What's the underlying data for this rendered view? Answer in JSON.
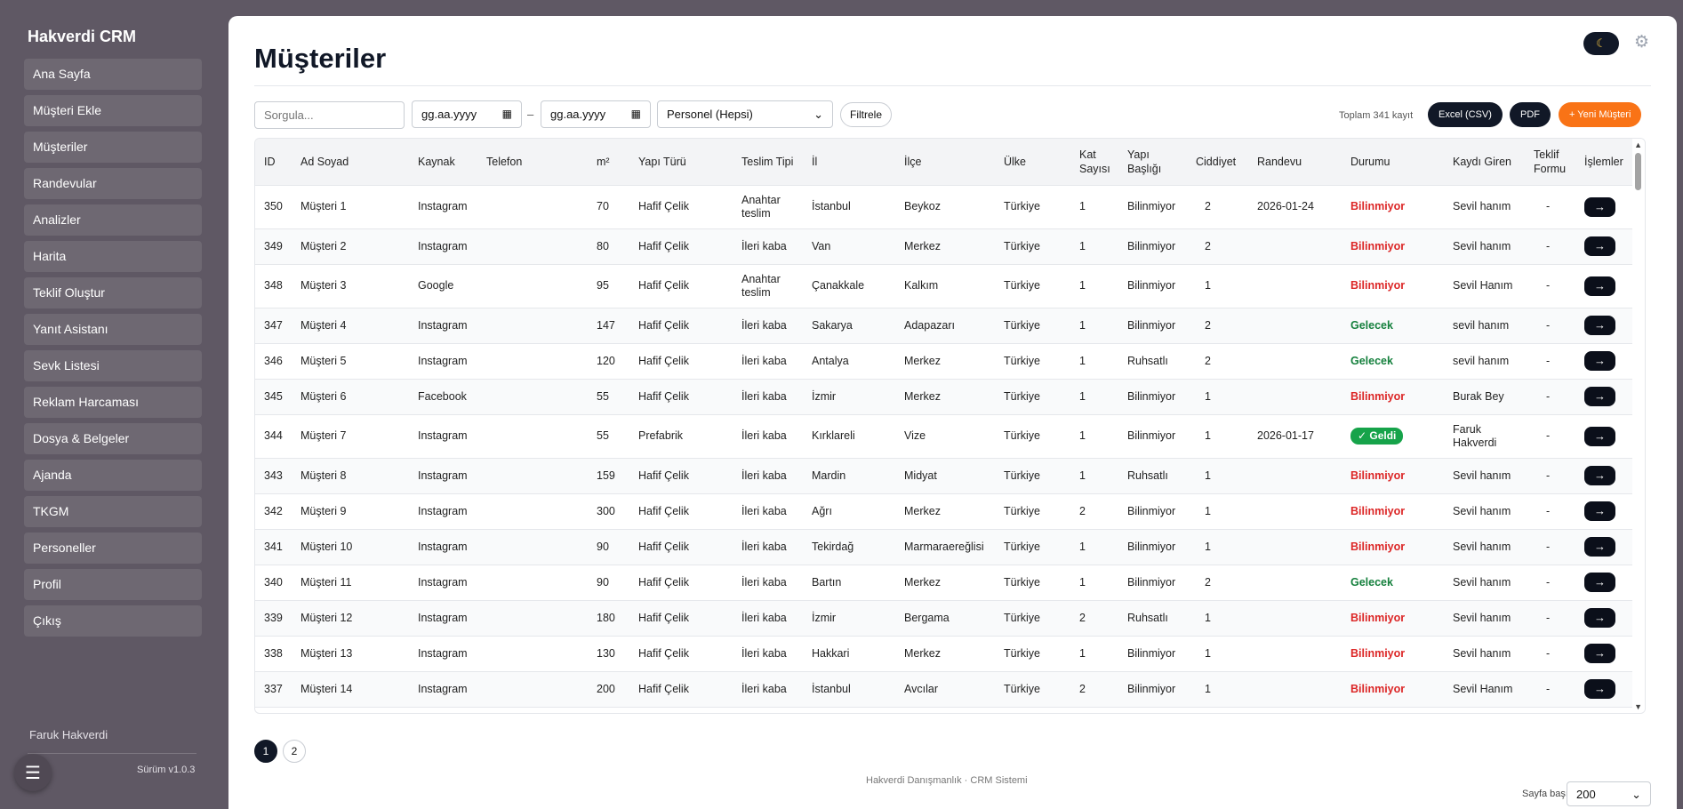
{
  "brand": "Hakverdi CRM",
  "nav": [
    "Ana Sayfa",
    "Müşteri Ekle",
    "Müşteriler",
    "Randevular",
    "Analizler",
    "Harita",
    "Teklif Oluştur",
    "Yanıt Asistanı",
    "Sevk Listesi",
    "Reklam Harcaması",
    "Dosya & Belgeler",
    "Ajanda",
    "TKGM",
    "Personeller",
    "Profil",
    "Çıkış"
  ],
  "user_name": "Faruk Hakverdi",
  "version": "Sürüm v1.0.3",
  "page_title": "Müşteriler",
  "toolbar": {
    "search_placeholder": "Sorgula...",
    "date_from": "gg.aa.yyyy",
    "date_to": "gg.aa.yyyy",
    "date_sep": "–",
    "personnel": "Personel (Hepsi)",
    "filter": "Filtrele",
    "total": "Toplam 341 kayıt",
    "excel": "Excel (CSV)",
    "pdf": "PDF",
    "new_customer": "+ Yeni Müşteri"
  },
  "columns": [
    "ID",
    "Ad Soyad",
    "Kaynak",
    "Telefon",
    "m²",
    "Yapı Türü",
    "Teslim Tipi",
    "İl",
    "İlçe",
    "Ülke",
    "Kat Sayısı",
    "Yapı Başlığı",
    "Ciddiyet",
    "Randevu",
    "Durumu",
    "Kaydı Giren",
    "Teklif Formu",
    "İşlemler"
  ],
  "rows": [
    {
      "id": "350",
      "name": "Müşteri 1",
      "source": "Instagram",
      "phone": "",
      "m2": "70",
      "type": "Hafif Çelik",
      "delivery": "Anahtar teslim",
      "city": "İstanbul",
      "district": "Beykoz",
      "country": "Türkiye",
      "floors": "1",
      "permit": "Bilinmiyor",
      "seriousness": "2",
      "appointment": "2026-01-24",
      "status": "Bilinmiyor",
      "status_kind": "red",
      "entered_by": "Sevil hanım",
      "offer": "-",
      "action": "→"
    },
    {
      "id": "349",
      "name": "Müşteri 2",
      "source": "Instagram",
      "phone": "",
      "m2": "80",
      "type": "Hafif Çelik",
      "delivery": "İleri kaba",
      "city": "Van",
      "district": "Merkez",
      "country": "Türkiye",
      "floors": "1",
      "permit": "Bilinmiyor",
      "seriousness": "2",
      "appointment": "",
      "status": "Bilinmiyor",
      "status_kind": "red",
      "entered_by": "Sevil hanım",
      "offer": "-",
      "action": "→"
    },
    {
      "id": "348",
      "name": "Müşteri 3",
      "source": "Google",
      "phone": "",
      "m2": "95",
      "type": "Hafif Çelik",
      "delivery": "Anahtar teslim",
      "city": "Çanakkale",
      "district": "Kalkım",
      "country": "Türkiye",
      "floors": "1",
      "permit": "Bilinmiyor",
      "seriousness": "1",
      "appointment": "",
      "status": "Bilinmiyor",
      "status_kind": "red",
      "entered_by": "Sevil Hanım",
      "offer": "-",
      "action": "→"
    },
    {
      "id": "347",
      "name": "Müşteri 4",
      "source": "Instagram",
      "phone": "",
      "m2": "147",
      "type": "Hafif Çelik",
      "delivery": "İleri kaba",
      "city": "Sakarya",
      "district": "Adapazarı",
      "country": "Türkiye",
      "floors": "1",
      "permit": "Bilinmiyor",
      "seriousness": "2",
      "appointment": "",
      "status": "Gelecek",
      "status_kind": "green",
      "entered_by": "sevil hanım",
      "offer": "-",
      "action": "→"
    },
    {
      "id": "346",
      "name": "Müşteri 5",
      "source": "Instagram",
      "phone": "",
      "m2": "120",
      "type": "Hafif Çelik",
      "delivery": "İleri kaba",
      "city": "Antalya",
      "district": "Merkez",
      "country": "Türkiye",
      "floors": "1",
      "permit": "Ruhsatlı",
      "seriousness": "2",
      "appointment": "",
      "status": "Gelecek",
      "status_kind": "green",
      "entered_by": "sevil hanım",
      "offer": "-",
      "action": "→"
    },
    {
      "id": "345",
      "name": "Müşteri 6",
      "source": "Facebook",
      "phone": "",
      "m2": "55",
      "type": "Hafif Çelik",
      "delivery": "İleri kaba",
      "city": "İzmir",
      "district": "Merkez",
      "country": "Türkiye",
      "floors": "1",
      "permit": "Bilinmiyor",
      "seriousness": "1",
      "appointment": "",
      "status": "Bilinmiyor",
      "status_kind": "red",
      "entered_by": "Burak Bey",
      "offer": "-",
      "action": "→"
    },
    {
      "id": "344",
      "name": "Müşteri 7",
      "source": "Instagram",
      "phone": "",
      "m2": "55",
      "type": "Prefabrik",
      "delivery": "İleri kaba",
      "city": "Kırklareli",
      "district": "Vize",
      "country": "Türkiye",
      "floors": "1",
      "permit": "Bilinmiyor",
      "seriousness": "1",
      "appointment": "2026-01-17",
      "status": "✓ Geldi",
      "status_kind": "badge",
      "entered_by": "Faruk Hakverdi",
      "offer": "-",
      "action": "→"
    },
    {
      "id": "343",
      "name": "Müşteri 8",
      "source": "Instagram",
      "phone": "",
      "m2": "159",
      "type": "Hafif Çelik",
      "delivery": "İleri kaba",
      "city": "Mardin",
      "district": "Midyat",
      "country": "Türkiye",
      "floors": "1",
      "permit": "Ruhsatlı",
      "seriousness": "1",
      "appointment": "",
      "status": "Bilinmiyor",
      "status_kind": "red",
      "entered_by": "Sevil hanım",
      "offer": "-",
      "action": "→"
    },
    {
      "id": "342",
      "name": "Müşteri 9",
      "source": "Instagram",
      "phone": "",
      "m2": "300",
      "type": "Hafif Çelik",
      "delivery": "İleri kaba",
      "city": "Ağrı",
      "district": "Merkez",
      "country": "Türkiye",
      "floors": "2",
      "permit": "Bilinmiyor",
      "seriousness": "1",
      "appointment": "",
      "status": "Bilinmiyor",
      "status_kind": "red",
      "entered_by": "Sevil hanım",
      "offer": "-",
      "action": "→"
    },
    {
      "id": "341",
      "name": "Müşteri 10",
      "source": "Instagram",
      "phone": "",
      "m2": "90",
      "type": "Hafif Çelik",
      "delivery": "İleri kaba",
      "city": "Tekirdağ",
      "district": "Marmaraereğlisi",
      "country": "Türkiye",
      "floors": "1",
      "permit": "Bilinmiyor",
      "seriousness": "1",
      "appointment": "",
      "status": "Bilinmiyor",
      "status_kind": "red",
      "entered_by": "Sevil hanım",
      "offer": "-",
      "action": "→"
    },
    {
      "id": "340",
      "name": "Müşteri 11",
      "source": "Instagram",
      "phone": "",
      "m2": "90",
      "type": "Hafif Çelik",
      "delivery": "İleri kaba",
      "city": "Bartın",
      "district": "Merkez",
      "country": "Türkiye",
      "floors": "1",
      "permit": "Bilinmiyor",
      "seriousness": "2",
      "appointment": "",
      "status": "Gelecek",
      "status_kind": "green",
      "entered_by": "Sevil hanım",
      "offer": "-",
      "action": "→"
    },
    {
      "id": "339",
      "name": "Müşteri 12",
      "source": "Instagram",
      "phone": "",
      "m2": "180",
      "type": "Hafif Çelik",
      "delivery": "İleri kaba",
      "city": "İzmir",
      "district": "Bergama",
      "country": "Türkiye",
      "floors": "2",
      "permit": "Ruhsatlı",
      "seriousness": "1",
      "appointment": "",
      "status": "Bilinmiyor",
      "status_kind": "red",
      "entered_by": "Sevil hanım",
      "offer": "-",
      "action": "→"
    },
    {
      "id": "338",
      "name": "Müşteri 13",
      "source": "Instagram",
      "phone": "",
      "m2": "130",
      "type": "Hafif Çelik",
      "delivery": "İleri kaba",
      "city": "Hakkari",
      "district": "Merkez",
      "country": "Türkiye",
      "floors": "1",
      "permit": "Bilinmiyor",
      "seriousness": "1",
      "appointment": "",
      "status": "Bilinmiyor",
      "status_kind": "red",
      "entered_by": "Sevil hanım",
      "offer": "-",
      "action": "→"
    },
    {
      "id": "337",
      "name": "Müşteri 14",
      "source": "Instagram",
      "phone": "",
      "m2": "200",
      "type": "Hafif Çelik",
      "delivery": "İleri kaba",
      "city": "İstanbul",
      "district": "Avcılar",
      "country": "Türkiye",
      "floors": "2",
      "permit": "Bilinmiyor",
      "seriousness": "1",
      "appointment": "",
      "status": "Bilinmiyor",
      "status_kind": "red",
      "entered_by": "Sevil Hanım",
      "offer": "-",
      "action": "→"
    }
  ],
  "pagination": [
    "1",
    "2"
  ],
  "footer": "Hakverdi Danışmanlık · CRM Sistemi",
  "per_page_label": "Sayfa başı",
  "per_page": "200",
  "icons": {
    "theme": "moon-icon",
    "settings": "gear-icon",
    "menu": "hamburger-icon",
    "calendar": "calendar-icon",
    "select": "chevron-down-icon"
  },
  "colors": {
    "sidebar_bg": "#5f5864",
    "nav_item_bg": "#6e6872",
    "dark": "#111827",
    "orange": "#f97316",
    "red": "#dc2626",
    "green": "#15803d"
  }
}
